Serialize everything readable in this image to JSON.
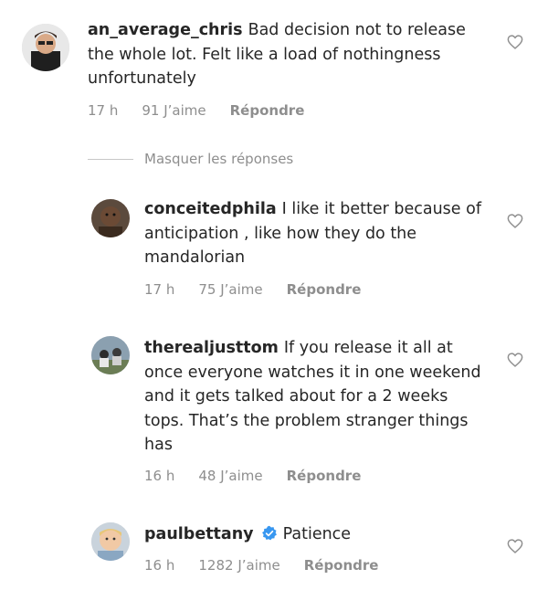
{
  "comments": [
    {
      "username": "an_average_chris",
      "text": "Bad decision not to release the whole lot. Felt like a load of nothingness unfortunately",
      "time": "17 h",
      "likes": "91 J’aime",
      "reply": "Répondre"
    },
    {
      "username": "conceitedphila",
      "text": "I like it better because of anticipation , like how they do the mandalorian",
      "time": "17 h",
      "likes": "75 J’aime",
      "reply": "Répondre"
    },
    {
      "username": "therealjusttom",
      "text": "If you release it all at once everyone watches it in one weekend and it gets talked about for a 2 weeks tops. That’s the problem stranger things has",
      "time": "16 h",
      "likes": "48 J’aime",
      "reply": "Répondre"
    },
    {
      "username": "paulbettany",
      "text": "Patience",
      "time": "16 h",
      "likes": "1282 J’aime",
      "reply": "Répondre",
      "verified": true
    }
  ],
  "hide_replies": "Masquer les réponses",
  "colors": {
    "verified": "#3897f0",
    "secondary_text": "#8e8e8e"
  }
}
